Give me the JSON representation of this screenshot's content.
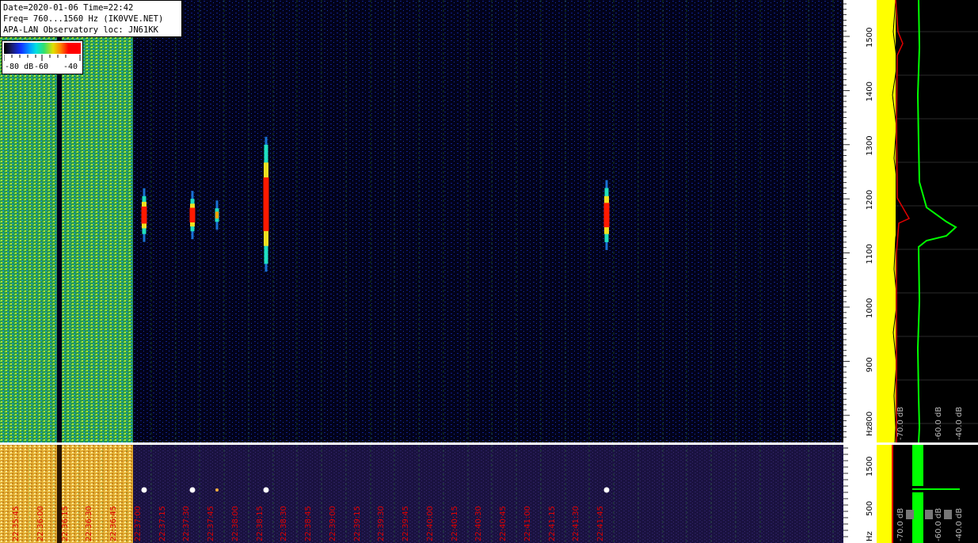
{
  "header": {
    "line1": "Date=2020-01-06 Time=22:42",
    "line2": "Freq= 760...1560 Hz (IK0VVE.NET)",
    "line3": "APA-LAN Observatory loc: JN61KK"
  },
  "colorbar": {
    "label_min": "-80 dB",
    "label_mid": "-60",
    "label_max": "-40"
  },
  "freq_axis": {
    "unit": "Hz",
    "ticks": [
      "1500",
      "1400",
      "1300",
      "1200",
      "1100",
      "1000",
      "900",
      "800"
    ],
    "tick_values": [
      1500,
      1400,
      1300,
      1200,
      1100,
      1000,
      900,
      800
    ],
    "min_hz": 760,
    "max_hz": 1560
  },
  "lower_axis": {
    "unit": "Hz",
    "ticks": [
      "1500",
      "500"
    ]
  },
  "spectrum_panel": {
    "labels_top": [
      "-70.0 dB",
      "-60.0 dB",
      "-40.0 dB"
    ],
    "labels_bottom": [
      "-70.0 dB",
      "-60.0 dB",
      "-40.0 dB"
    ],
    "colors": {
      "avg": "#ffff00",
      "peak": "#e00000",
      "smooth": "#00ff00"
    }
  },
  "time_labels": [
    "22:35:45",
    "22:36:00",
    "22:36:15",
    "22:36:30",
    "22:36:45",
    "22:37:00",
    "22:37:15",
    "22:37:30",
    "22:37:45",
    "22:38:00",
    "22:38:15",
    "22:38:30",
    "22:38:45",
    "22:39:00",
    "22:39:15",
    "22:39:30",
    "22:39:45",
    "22:40:00",
    "22:40:15",
    "22:40:30",
    "22:40:45",
    "22:41:00",
    "22:41:15",
    "22:41:30",
    "22:41:45"
  ],
  "detections": [
    {
      "time": "22:37:00",
      "freq_hz": 1170,
      "length_hz": 70,
      "strength": "strong"
    },
    {
      "time": "22:37:30",
      "freq_hz": 1170,
      "length_hz": 60,
      "strength": "strong"
    },
    {
      "time": "22:37:45",
      "freq_hz": 1170,
      "length_hz": 25,
      "strength": "weak"
    },
    {
      "time": "22:38:15",
      "freq_hz": 1190,
      "length_hz": 220,
      "strength": "strong"
    },
    {
      "time": "22:41:45",
      "freq_hz": 1170,
      "length_hz": 100,
      "strength": "strong"
    }
  ],
  "colors": {
    "background": "#000000",
    "noise_green": "#30c060",
    "noise_orange": "#e0a020",
    "grid_green": "#38a838",
    "time_label_red": "#e00000",
    "lower_bg": "#1a1030"
  }
}
